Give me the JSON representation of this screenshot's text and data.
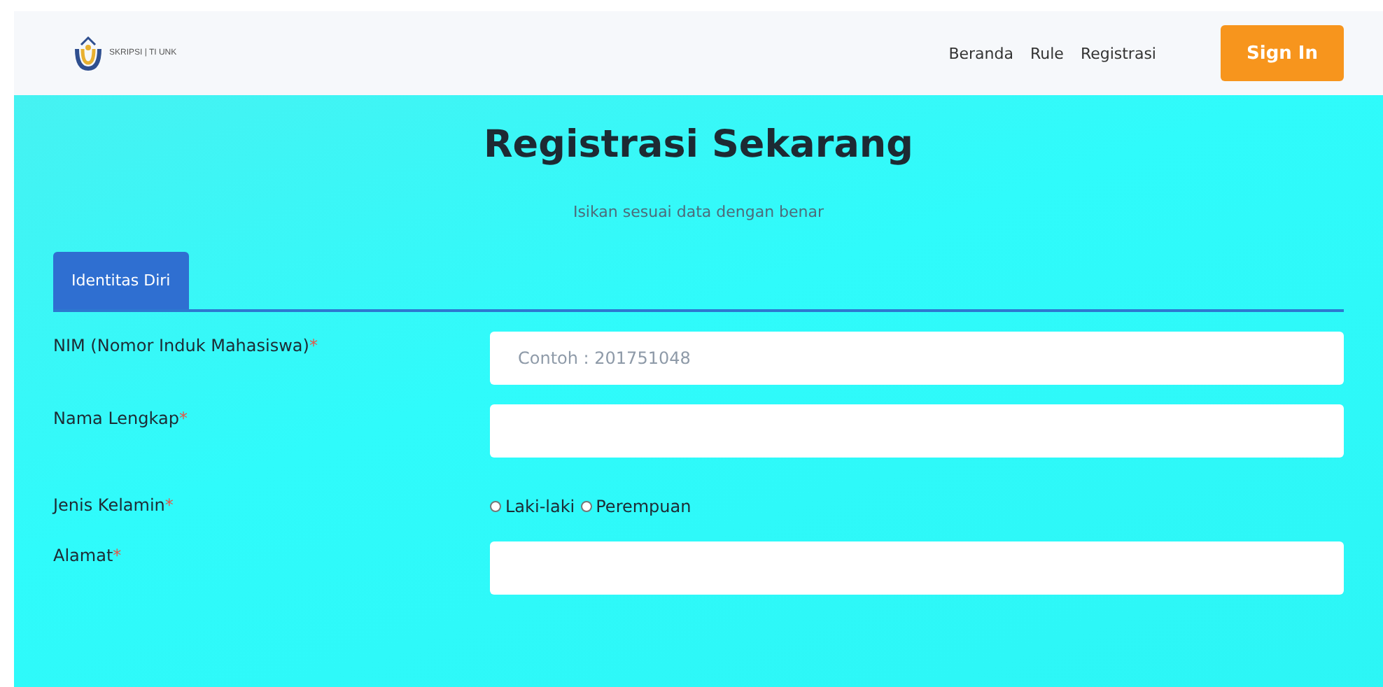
{
  "navbar": {
    "logo_text": "SKRIPSI | TI UNK",
    "links": [
      "Beranda",
      "Rule",
      "Registrasi"
    ],
    "button": "Sign In"
  },
  "heading": "Registrasi Sekarang",
  "subtitle": "Isikan sesuai data dengan benar",
  "tabs": [
    {
      "label": "Identitas Diri",
      "selected": true
    }
  ],
  "fields": [
    {
      "kind": "text",
      "label": "NIM (Nomor Induk Mahasiswa)",
      "required_mark": "*",
      "placeholder": "Contoh : 201751048"
    },
    {
      "kind": "text",
      "label": "Nama Lengkap",
      "required_mark": "*"
    },
    {
      "kind": "radio",
      "label": "Jenis Kelamin",
      "required_mark": "*",
      "options": [
        {
          "label": "Laki-laki",
          "selected": false
        },
        {
          "label": "Perempuan",
          "selected": false
        }
      ]
    },
    {
      "kind": "text",
      "label": "Alamat",
      "required_mark": "*"
    }
  ]
}
